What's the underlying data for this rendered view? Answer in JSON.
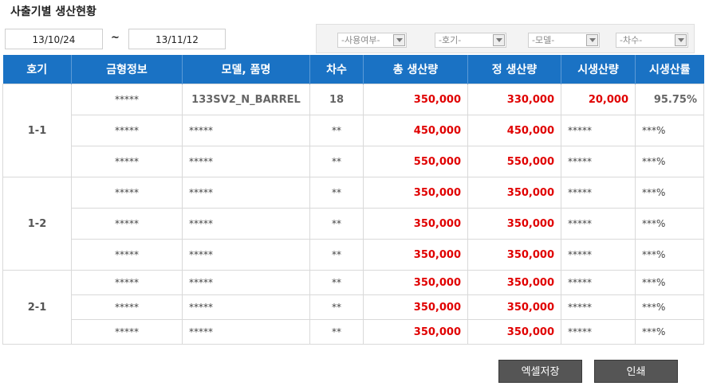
{
  "page": {
    "title": "사출기별 생산현황"
  },
  "filters": {
    "date_from": "13/10/24",
    "separator": "~",
    "date_to": "13/11/12",
    "use_yn": "-사용여부-",
    "machine": "-호기-",
    "model": "-모델-",
    "order": "-차수-"
  },
  "table": {
    "headers": [
      "호기",
      "금형정보",
      "모델, 품명",
      "차수",
      "총 생산량",
      "정 생산량",
      "시생산량",
      "시생산률"
    ],
    "groups": [
      {
        "label": "1-1",
        "rows": [
          [
            "*****",
            "133SV2_N_BARREL",
            "18",
            "350,000",
            "330,000",
            "20,000",
            "95.75%"
          ],
          [
            "*****",
            "*****",
            "**",
            "450,000",
            "450,000",
            "*****",
            "***%"
          ],
          [
            "*****",
            "*****",
            "**",
            "550,000",
            "550,000",
            "*****",
            "***%"
          ]
        ]
      },
      {
        "label": "1-2",
        "rows": [
          [
            "*****",
            "*****",
            "**",
            "350,000",
            "350,000",
            "*****",
            "***%"
          ],
          [
            "*****",
            "*****",
            "**",
            "350,000",
            "350,000",
            "*****",
            "***%"
          ],
          [
            "*****",
            "*****",
            "**",
            "350,000",
            "350,000",
            "*****",
            "***%"
          ]
        ]
      },
      {
        "label": "2-1",
        "rows": [
          [
            "*****",
            "*****",
            "**",
            "350,000",
            "350,000",
            "*****",
            "***%"
          ],
          [
            "*****",
            "*****",
            "**",
            "350,000",
            "350,000",
            "*****",
            "***%"
          ],
          [
            "*****",
            "*****",
            "**",
            "350,000",
            "350,000",
            "*****",
            "***%"
          ]
        ]
      }
    ]
  },
  "buttons": {
    "excel": "엑셀저장",
    "print": "인쇄"
  }
}
